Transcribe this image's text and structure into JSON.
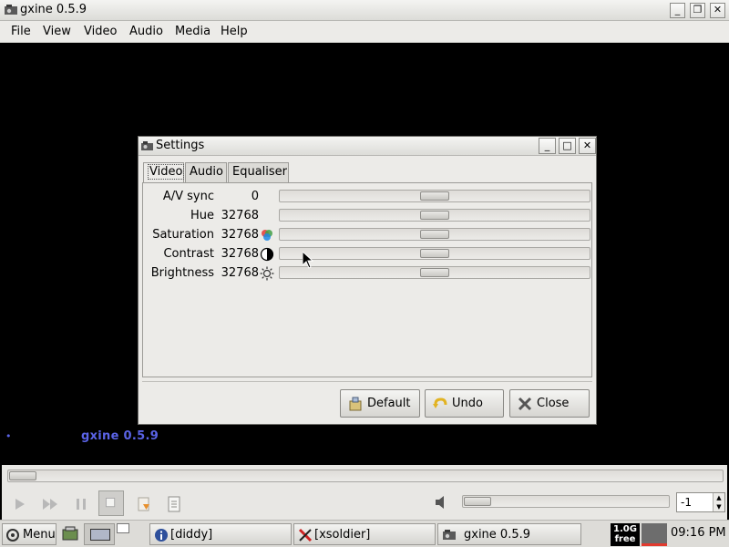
{
  "window": {
    "title": "gxine 0.5.9",
    "controls": [
      "_",
      "❐",
      "✕"
    ]
  },
  "menubar": {
    "items": [
      {
        "label": "File"
      },
      {
        "label": "View"
      },
      {
        "label": "Video"
      },
      {
        "label": "Audio"
      },
      {
        "label": "Media"
      },
      {
        "label": "Help"
      }
    ]
  },
  "osd": {
    "dot": "•",
    "title": "gxine 0.5.9"
  },
  "seek": {
    "position": 0.0
  },
  "controls": {
    "volume_level": 0.0,
    "spin_value": "-1"
  },
  "settings": {
    "title": "Settings",
    "tabs": [
      {
        "label": "Video"
      },
      {
        "label": "Audio"
      },
      {
        "label": "Equaliser"
      }
    ],
    "active_tab": "Video",
    "rows": [
      {
        "label": "A/V sync",
        "value": "0",
        "icon": "",
        "slider": 0.5
      },
      {
        "label": "Hue",
        "value": "32768",
        "icon": "",
        "slider": 0.5
      },
      {
        "label": "Saturation",
        "value": "32768",
        "icon": "color-wheel-icon",
        "slider": 0.5
      },
      {
        "label": "Contrast",
        "value": "32768",
        "icon": "contrast-icon",
        "slider": 0.5
      },
      {
        "label": "Brightness",
        "value": "32768",
        "icon": "brightness-icon",
        "slider": 0.5
      }
    ],
    "buttons": {
      "default_label": "Default",
      "undo_label": "Undo",
      "close_label": "Close"
    }
  },
  "taskbar": {
    "menu_label": "Menu",
    "tasks": [
      {
        "label": "[diddy]"
      },
      {
        "label": "[xsoldier]"
      },
      {
        "label": "gxine 0.5.9"
      }
    ],
    "memory": {
      "value": "1.0G",
      "unit": "free"
    },
    "clock": "09:16 PM"
  }
}
